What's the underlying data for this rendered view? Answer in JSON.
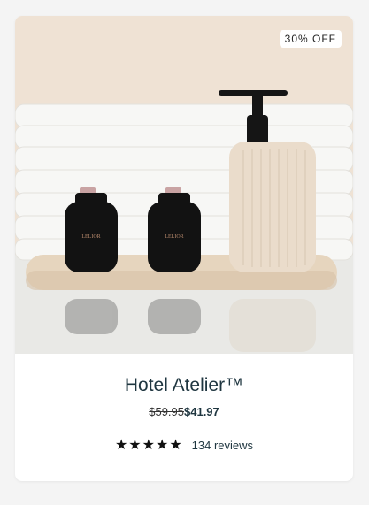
{
  "product": {
    "badge": "30% OFF",
    "title": "Hotel Atelier™",
    "original_price": "$59.95",
    "sale_price": "$41.97",
    "rating": 5,
    "stars": "★★★★★",
    "reviews_label": "134 reviews",
    "bottle_label": "LELIOR"
  },
  "colors": {
    "background_wall": "#efe2d4",
    "title": "#1f3640",
    "bottle": "#121212",
    "dispenser": "#eadccb"
  }
}
